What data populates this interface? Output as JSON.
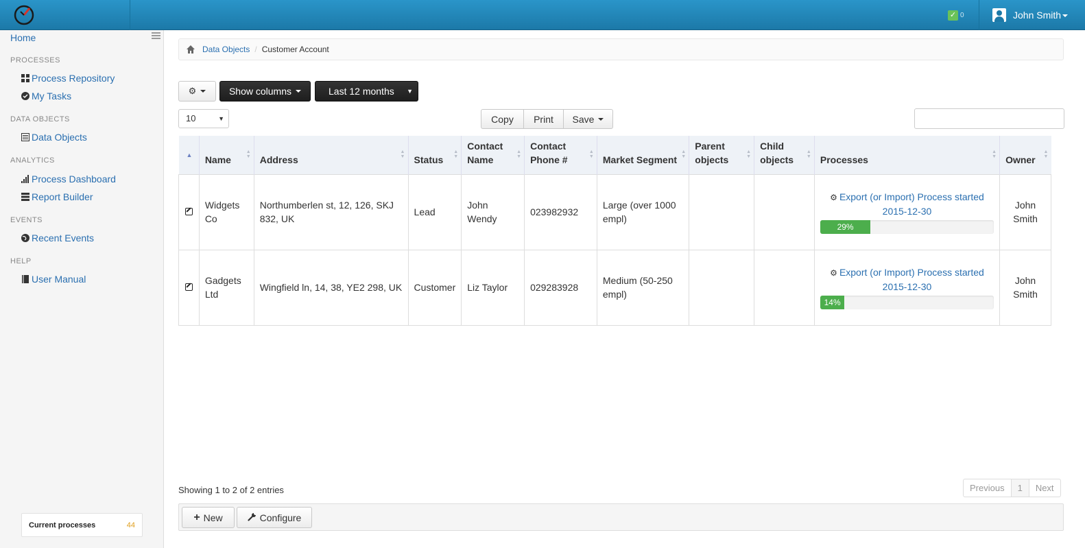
{
  "header": {
    "tasks_count": "0",
    "user_name": "John Smith"
  },
  "sidebar": {
    "home": "Home",
    "sections": [
      {
        "title": "PROCESSES",
        "items": [
          {
            "label": "Process Repository",
            "icon": "grid-icon"
          },
          {
            "label": "My Tasks",
            "icon": "check-circle-icon"
          }
        ]
      },
      {
        "title": "DATA OBJECTS",
        "items": [
          {
            "label": "Data Objects",
            "icon": "list-icon"
          }
        ]
      },
      {
        "title": "ANALYTICS",
        "items": [
          {
            "label": "Process Dashboard",
            "icon": "bar-chart-icon"
          },
          {
            "label": "Report Builder",
            "icon": "report-icon"
          }
        ]
      },
      {
        "title": "EVENTS",
        "items": [
          {
            "label": "Recent Events",
            "icon": "globe-icon"
          }
        ]
      },
      {
        "title": "HELP",
        "items": [
          {
            "label": "User Manual",
            "icon": "book-icon"
          }
        ]
      }
    ],
    "current_processes_label": "Current processes",
    "current_processes_count": "44"
  },
  "breadcrumb": {
    "items": [
      "Data Objects",
      "Customer Account"
    ]
  },
  "toolbar": {
    "show_columns": "Show columns",
    "period": "Last 12 months",
    "page_length": "10",
    "copy": "Copy",
    "print": "Print",
    "save": "Save",
    "search_value": ""
  },
  "table": {
    "headers": {
      "name": "Name",
      "address": "Address",
      "status": "Status",
      "contact_name": "Contact Name",
      "contact_phone": "Contact Phone #",
      "market_segment": "Market Segment",
      "parent_objects": "Parent objects",
      "child_objects": "Child objects",
      "processes": "Processes",
      "owner": "Owner"
    },
    "rows": [
      {
        "name": "Widgets Co",
        "address": "Northumberlen st, 12, 126, SKJ 832, UK",
        "status": "Lead",
        "contact_name": "John Wendy",
        "contact_phone": "023982932",
        "market_segment": "Large (over 1000 empl)",
        "parent_objects": "",
        "child_objects": "",
        "process_label": "Export (or Import) Process started 2015-12-30",
        "progress": 29,
        "progress_label": "29%",
        "owner": "John Smith"
      },
      {
        "name": "Gadgets Ltd",
        "address": "Wingfield ln, 14, 38, YE2 298, UK",
        "status": "Customer",
        "contact_name": "Liz Taylor",
        "contact_phone": "029283928",
        "market_segment": "Medium (50-250 empl)",
        "parent_objects": "",
        "child_objects": "",
        "process_label": "Export (or Import) Process started 2015-12-30",
        "progress": 14,
        "progress_label": "14%",
        "owner": "John Smith"
      }
    ]
  },
  "info": "Showing 1 to 2 of 2 entries",
  "pagination": {
    "previous": "Previous",
    "page": "1",
    "next": "Next"
  },
  "footer": {
    "new": "New",
    "configure": "Configure"
  },
  "colors": {
    "topbar": "#1c79a8",
    "link": "#2a6fb0",
    "progress": "#4cae4c",
    "badge": "#6ac259"
  }
}
